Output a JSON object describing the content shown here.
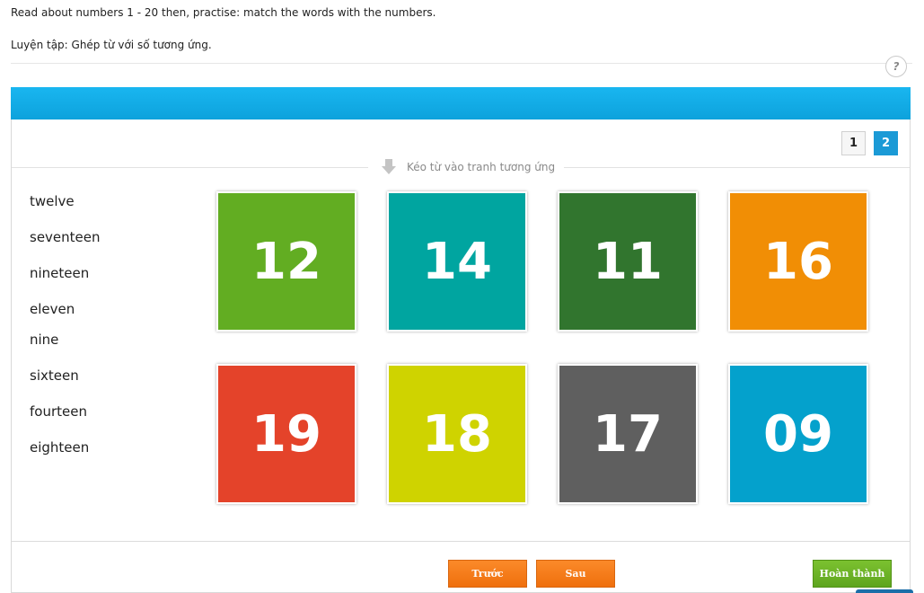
{
  "instructions": {
    "english": "Read about numbers 1 - 20 then, practise: match the words with the numbers.",
    "vietnamese": "Luyện tập: Ghép từ với số tương ứng."
  },
  "help": {
    "label": "?"
  },
  "pagination": {
    "pages": [
      "1",
      "2"
    ],
    "current": "2"
  },
  "drag_hint": "Kéo từ vào tranh tương ứng",
  "words": [
    "twelve",
    "seventeen",
    "nineteen",
    "eleven",
    "nine",
    "sixteen",
    "fourteen",
    "eighteen"
  ],
  "tiles": [
    {
      "number": "12",
      "color": "#62ad22"
    },
    {
      "number": "14",
      "color": "#00a5a0"
    },
    {
      "number": "11",
      "color": "#31752e"
    },
    {
      "number": "16",
      "color": "#f18e05"
    },
    {
      "number": "19",
      "color": "#e4432a"
    },
    {
      "number": "18",
      "color": "#cfd300"
    },
    {
      "number": "17",
      "color": "#5f5f5f"
    },
    {
      "number": "09",
      "color": "#04a1cc"
    }
  ],
  "buttons": {
    "prev": "Trước",
    "next": "Sau",
    "done": "Hoàn thành"
  },
  "colors": {
    "header": "#0ea8e2",
    "active_page": "#1b9ad6",
    "nav_button": "#f47c1c",
    "done_button": "#6db526"
  }
}
